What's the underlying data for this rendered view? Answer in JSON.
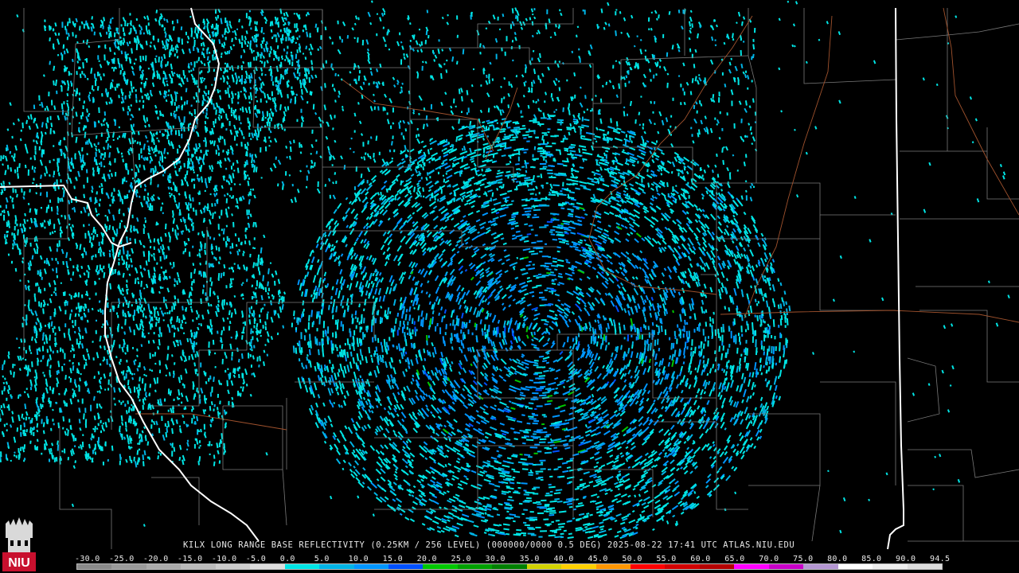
{
  "product": {
    "caption": "KILX LONG RANGE BASE REFLECTIVITY (0.25KM / 256 LEVEL) (000000/0000 0.5 DEG) 2025-08-22 17:41 UTC  ATLAS.NIU.EDU"
  },
  "colorbar": {
    "ticks": [
      "-30.0",
      "-25.0",
      "-20.0",
      "-15.0",
      "-10.0",
      "-5.0",
      "0.0",
      "5.0",
      "10.0",
      "15.0",
      "20.0",
      "25.0",
      "30.0",
      "35.0",
      "40.0",
      "45.0",
      "50.0",
      "55.0",
      "60.0",
      "65.0",
      "70.0",
      "75.0",
      "80.0",
      "85.0",
      "90.0",
      "94.5"
    ],
    "colors": [
      "#8a8a8a",
      "#9a9a9a",
      "#aaaaaa",
      "#bbbbbb",
      "#cccccc",
      "#dddddd",
      "#00e5e5",
      "#00b4e6",
      "#0096ff",
      "#0050ff",
      "#00c800",
      "#00a000",
      "#008000",
      "#d2d200",
      "#ffd000",
      "#ff9600",
      "#ff0000",
      "#d20000",
      "#b40000",
      "#ff00ff",
      "#c800c8",
      "#b496d2",
      "#ffffff",
      "#eeeeee",
      "#dddddd"
    ]
  },
  "logo": {
    "text": "NIU"
  },
  "colors": {
    "background": "#000000",
    "county_lines": "#7a7a7a",
    "state_lines": "#ffffff",
    "rivers": "#a0522d"
  }
}
